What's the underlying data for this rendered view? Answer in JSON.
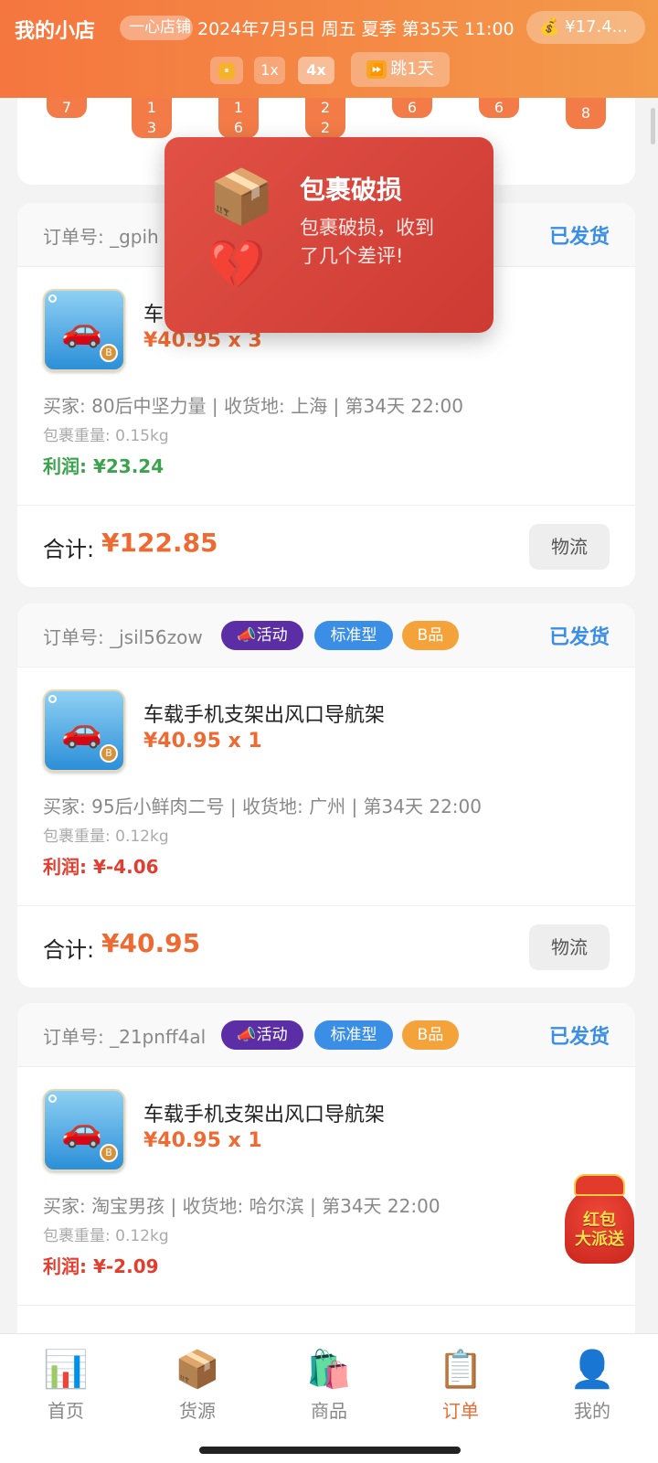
{
  "header": {
    "title": "我的小店",
    "shop_pill": "一心店铺",
    "datetime": "2024年7月5日 周五 夏季 第35天 11:00",
    "money": "¥17.4...",
    "money_icon": "money-bag-icon",
    "speed": {
      "pause": "⏸",
      "x1": "1x",
      "x4": "4x",
      "skip": "跳1天"
    }
  },
  "top_card": {
    "bubbles": [
      "7",
      "1\n3",
      "1\n6",
      "2\n2",
      "6",
      "6",
      "8"
    ]
  },
  "orders": [
    {
      "order_no": "订单号: _gpih",
      "status": "已发货",
      "product_name": "车",
      "price": "¥40.95 x 3",
      "buyer": "买家: 80后中坚力量 | 收货地: 上海 | 第34天 22:00",
      "weight": "包裹重量: 0.15kg",
      "profit": "利润: ¥23.24",
      "total_label": "合计:",
      "total": "¥122.85",
      "logistics": "物流"
    },
    {
      "order_no": "订单号: _jsil56zow",
      "tags": {
        "activity": "📣活动",
        "type": "标准型",
        "grade": "B品"
      },
      "status": "已发货",
      "product_name": "车载手机支架出风口导航架",
      "price": "¥40.95 x 1",
      "buyer": "买家: 95后小鲜肉二号 | 收货地: 广州 | 第34天 22:00",
      "weight": "包裹重量: 0.12kg",
      "profit": "利润: ¥-4.06",
      "total_label": "合计:",
      "total": "¥40.95",
      "logistics": "物流"
    },
    {
      "order_no": "订单号: _21pnff4al",
      "tags": {
        "activity": "📣活动",
        "type": "标准型",
        "grade": "B品"
      },
      "status": "已发货",
      "product_name": "车载手机支架出风口导航架",
      "price": "¥40.95 x 1",
      "buyer": "买家: 淘宝男孩 | 收货地: 哈尔滨 | 第34天 22:00",
      "weight": "包裹重量: 0.12kg",
      "profit": "利润: ¥-2.09"
    }
  ],
  "toast": {
    "title": "包裹破损",
    "message": "包裹破损，收到了几个差评!",
    "icons": [
      "package-icon",
      "broken-heart-icon"
    ]
  },
  "redpack": {
    "text": "红包\n大派送"
  },
  "nav": [
    {
      "label": "首页",
      "icon": "chart-icon"
    },
    {
      "label": "货源",
      "icon": "package-icon"
    },
    {
      "label": "商品",
      "icon": "shopping-bag-icon"
    },
    {
      "label": "订单",
      "icon": "clipboard-icon",
      "active": true
    },
    {
      "label": "我的",
      "icon": "user-icon"
    }
  ],
  "colors": {
    "header_start": "#f5763f",
    "header_end": "#f39a4b",
    "accent": "#ef6a32",
    "status_blue": "#3a8ee6",
    "profit_positive": "#3ba34d",
    "profit_negative": "#e23d2e",
    "toast_red": "#cc3a33"
  }
}
